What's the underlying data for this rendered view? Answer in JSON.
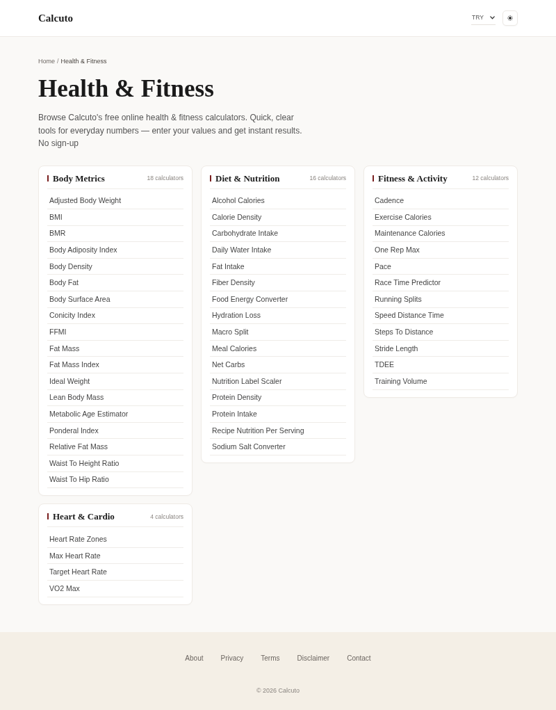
{
  "header": {
    "logo": "Calcuto",
    "currency_select": {
      "value": "TRY"
    }
  },
  "breadcrumb": {
    "items": [
      {
        "label": "Home",
        "kind": "link"
      },
      {
        "label": "Health & Fitness",
        "kind": "current"
      }
    ],
    "separator": "/"
  },
  "page_title": "Health & Fitness",
  "description": "Browse Calcuto's free online health & fitness calculators. Quick, clear tools for everyday numbers — enter your values and get instant results. No sign-up",
  "categories": [
    {
      "title": "Body Metrics",
      "count": "18 calculators",
      "items": [
        "Adjusted Body Weight",
        "BMI",
        "BMR",
        "Body Adiposity Index",
        "Body Density",
        "Body Fat",
        "Body Surface Area",
        "Conicity Index",
        "FFMI",
        "Fat Mass",
        "Fat Mass Index",
        "Ideal Weight",
        "Lean Body Mass",
        "Metabolic Age Estimator",
        "Ponderal Index",
        "Relative Fat Mass",
        "Waist To Height Ratio",
        "Waist To Hip Ratio"
      ]
    },
    {
      "title": "Diet & Nutrition",
      "count": "16 calculators",
      "items": [
        "Alcohol Calories",
        "Calorie Density",
        "Carbohydrate Intake",
        "Daily Water Intake",
        "Fat Intake",
        "Fiber Density",
        "Food Energy Converter",
        "Hydration Loss",
        "Macro Split",
        "Meal Calories",
        "Net Carbs",
        "Nutrition Label Scaler",
        "Protein Density",
        "Protein Intake",
        "Recipe Nutrition Per Serving",
        "Sodium Salt Converter"
      ]
    },
    {
      "title": "Fitness & Activity",
      "count": "12 calculators",
      "items": [
        "Cadence",
        "Exercise Calories",
        "Maintenance Calories",
        "One Rep Max",
        "Pace",
        "Race Time Predictor",
        "Running Splits",
        "Speed Distance Time",
        "Steps To Distance",
        "Stride Length",
        "TDEE",
        "Training Volume"
      ]
    },
    {
      "title": "Heart & Cardio",
      "count": "4 calculators",
      "items": [
        "Heart Rate Zones",
        "Max Heart Rate",
        "Target Heart Rate",
        "VO2 Max"
      ]
    }
  ],
  "footer": {
    "links": [
      "About",
      "Privacy",
      "Terms",
      "Disclaimer",
      "Contact"
    ],
    "copyright": "© 2026 Calcuto"
  }
}
